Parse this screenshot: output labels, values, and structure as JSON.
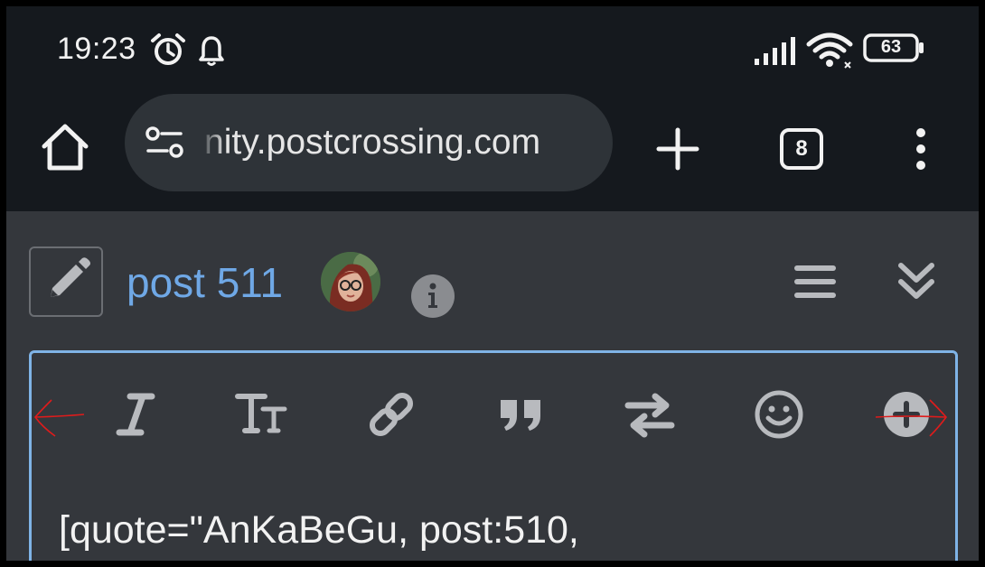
{
  "status_bar": {
    "time": "19:23",
    "battery": "63",
    "icons": [
      "alarm-icon",
      "bell-icon",
      "signal-icon",
      "wifi-icon",
      "battery-icon"
    ]
  },
  "browser": {
    "url": "nity.postcrossing.com",
    "tab_count": "8",
    "icons": [
      "home-icon",
      "tune-icon",
      "plus-icon",
      "tabs-icon",
      "more-vert-icon"
    ]
  },
  "topic": {
    "title": "post 511",
    "icons": [
      "pencil-icon",
      "avatar",
      "info-icon",
      "hamburger-icon",
      "chevrons-down-icon"
    ]
  },
  "composer": {
    "toolbar": [
      "italic-icon",
      "text-size-icon",
      "link-icon",
      "quote-icon",
      "swap-icon",
      "emoji-icon",
      "add-circle-icon"
    ],
    "text": "[quote=\"AnKaBeGu, post:510,"
  },
  "colors": {
    "status_bg": "#15191e",
    "page_bg": "#34373c",
    "link_blue": "#6fa8e6",
    "editor_border": "#7fb3e6",
    "annotation_red": "#e01b1b"
  }
}
